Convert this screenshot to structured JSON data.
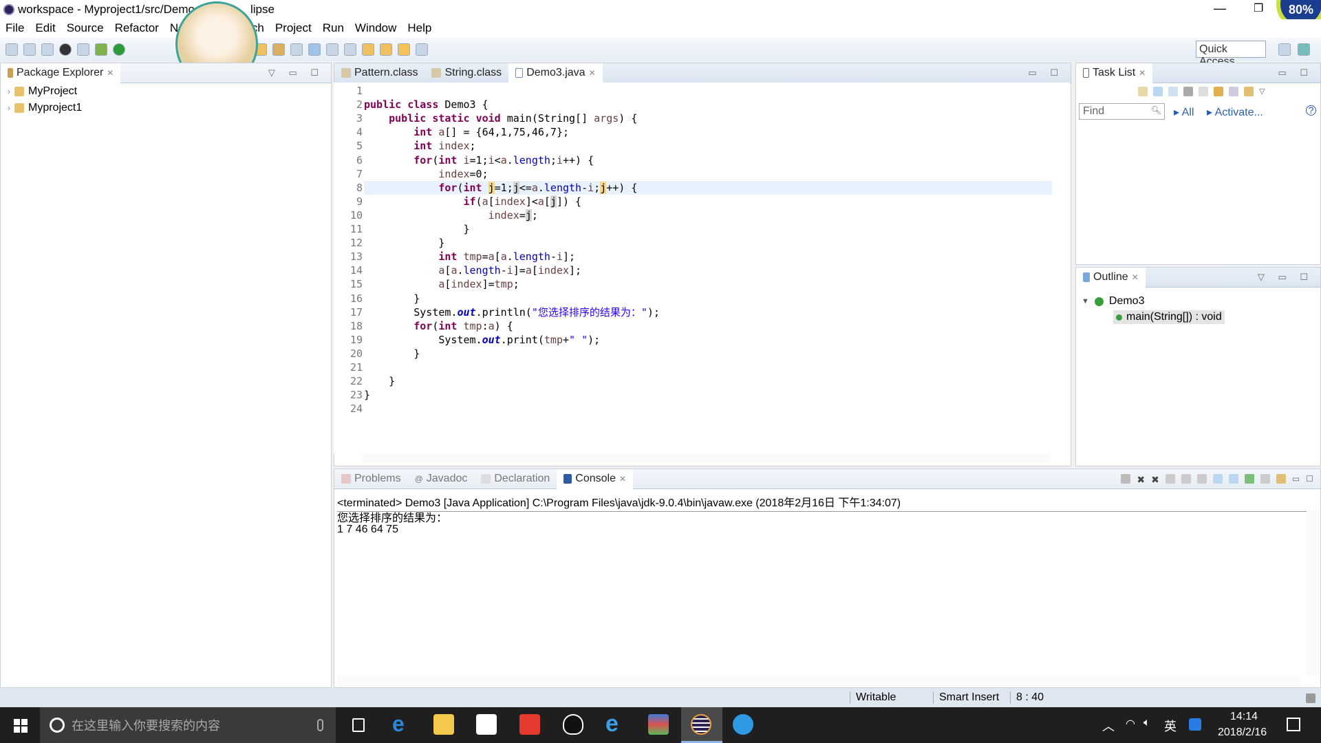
{
  "window": {
    "title": "workspace - Myproject1/src/Demo3.java - Eclipse",
    "title_visible": "workspace - Myproject1/src/Demo",
    "title_suffix": "lipse",
    "overlay_badge": "80%"
  },
  "menu": [
    "File",
    "Edit",
    "Source",
    "Refactor",
    "Navigate",
    "Search",
    "Project",
    "Run",
    "Window",
    "Help"
  ],
  "toolbar": {
    "quick_access": "Quick Access"
  },
  "package_explorer": {
    "title": "Package Explorer",
    "items": [
      "MyProject",
      "Myproject1"
    ]
  },
  "editor": {
    "tabs": [
      {
        "label": "Pattern.class",
        "active": false
      },
      {
        "label": "String.class",
        "active": false
      },
      {
        "label": "Demo3.java",
        "active": true
      }
    ],
    "current_line": 8,
    "lines": [
      [],
      [
        [
          "k",
          "public"
        ],
        [
          "t",
          " "
        ],
        [
          "k",
          "class"
        ],
        [
          "t",
          " Demo3 {"
        ]
      ],
      [
        [
          "t",
          "    "
        ],
        [
          "k",
          "public"
        ],
        [
          "t",
          " "
        ],
        [
          "k",
          "static"
        ],
        [
          "t",
          " "
        ],
        [
          "k",
          "void"
        ],
        [
          "t",
          " main(String[] "
        ],
        [
          "v",
          "args"
        ],
        [
          "t",
          ") {"
        ]
      ],
      [
        [
          "t",
          "        "
        ],
        [
          "k",
          "int"
        ],
        [
          "t",
          " "
        ],
        [
          "v",
          "a"
        ],
        [
          "t",
          "[] = {64,1,75,46,7};"
        ]
      ],
      [
        [
          "t",
          "        "
        ],
        [
          "k",
          "int"
        ],
        [
          "t",
          " "
        ],
        [
          "v",
          "index"
        ],
        [
          "t",
          ";"
        ]
      ],
      [
        [
          "t",
          "        "
        ],
        [
          "k",
          "for"
        ],
        [
          "t",
          "("
        ],
        [
          "k",
          "int"
        ],
        [
          "t",
          " "
        ],
        [
          "v",
          "i"
        ],
        [
          "t",
          "=1;"
        ],
        [
          "v",
          "i"
        ],
        [
          "t",
          "<"
        ],
        [
          "v",
          "a"
        ],
        [
          "t",
          "."
        ],
        [
          "f",
          "length"
        ],
        [
          "t",
          ";"
        ],
        [
          "v",
          "i"
        ],
        [
          "t",
          "++) {"
        ]
      ],
      [
        [
          "t",
          "            "
        ],
        [
          "v",
          "index"
        ],
        [
          "t",
          "=0;"
        ]
      ],
      [
        [
          "t",
          "            "
        ],
        [
          "k",
          "for"
        ],
        [
          "t",
          "("
        ],
        [
          "k",
          "int"
        ],
        [
          "t",
          " "
        ],
        [
          "occw",
          "j"
        ],
        [
          "t",
          "=1;"
        ],
        [
          "occ",
          "j"
        ],
        [
          "t",
          "<="
        ],
        [
          "v",
          "a"
        ],
        [
          "t",
          "."
        ],
        [
          "f",
          "length"
        ],
        [
          "t",
          "-"
        ],
        [
          "v",
          "i"
        ],
        [
          "t",
          ";"
        ],
        [
          "occw",
          "j"
        ],
        [
          "t",
          "++) {"
        ]
      ],
      [
        [
          "t",
          "                "
        ],
        [
          "k",
          "if"
        ],
        [
          "t",
          "("
        ],
        [
          "v",
          "a"
        ],
        [
          "t",
          "["
        ],
        [
          "v",
          "index"
        ],
        [
          "t",
          "]<"
        ],
        [
          "v",
          "a"
        ],
        [
          "t",
          "["
        ],
        [
          "occ",
          "j"
        ],
        [
          "t",
          "]) {"
        ]
      ],
      [
        [
          "t",
          "                    "
        ],
        [
          "v",
          "index"
        ],
        [
          "t",
          "="
        ],
        [
          "occ",
          "j"
        ],
        [
          "t",
          ";"
        ]
      ],
      [
        [
          "t",
          "                }"
        ]
      ],
      [
        [
          "t",
          "            }"
        ]
      ],
      [
        [
          "t",
          "            "
        ],
        [
          "k",
          "int"
        ],
        [
          "t",
          " "
        ],
        [
          "v",
          "tmp"
        ],
        [
          "t",
          "="
        ],
        [
          "v",
          "a"
        ],
        [
          "t",
          "["
        ],
        [
          "v",
          "a"
        ],
        [
          "t",
          "."
        ],
        [
          "f",
          "length"
        ],
        [
          "t",
          "-"
        ],
        [
          "v",
          "i"
        ],
        [
          "t",
          "];"
        ]
      ],
      [
        [
          "t",
          "            "
        ],
        [
          "v",
          "a"
        ],
        [
          "t",
          "["
        ],
        [
          "v",
          "a"
        ],
        [
          "t",
          "."
        ],
        [
          "f",
          "length"
        ],
        [
          "t",
          "-"
        ],
        [
          "v",
          "i"
        ],
        [
          "t",
          "]="
        ],
        [
          "v",
          "a"
        ],
        [
          "t",
          "["
        ],
        [
          "v",
          "index"
        ],
        [
          "t",
          "];"
        ]
      ],
      [
        [
          "t",
          "            "
        ],
        [
          "v",
          "a"
        ],
        [
          "t",
          "["
        ],
        [
          "v",
          "index"
        ],
        [
          "t",
          "]="
        ],
        [
          "v",
          "tmp"
        ],
        [
          "t",
          ";"
        ]
      ],
      [
        [
          "t",
          "        }"
        ]
      ],
      [
        [
          "t",
          "        System."
        ],
        [
          "o",
          "out"
        ],
        [
          "t",
          ".println("
        ],
        [
          "s",
          "\"您选择排序的结果为：\""
        ],
        [
          "t",
          ");"
        ]
      ],
      [
        [
          "t",
          "        "
        ],
        [
          "k",
          "for"
        ],
        [
          "t",
          "("
        ],
        [
          "k",
          "int"
        ],
        [
          "t",
          " "
        ],
        [
          "v",
          "tmp"
        ],
        [
          "t",
          ":"
        ],
        [
          "v",
          "a"
        ],
        [
          "t",
          ") {"
        ]
      ],
      [
        [
          "t",
          "            System."
        ],
        [
          "o",
          "out"
        ],
        [
          "t",
          ".print("
        ],
        [
          "v",
          "tmp"
        ],
        [
          "t",
          "+"
        ],
        [
          "s",
          "\" \""
        ],
        [
          "t",
          ");"
        ]
      ],
      [
        [
          "t",
          "        }"
        ]
      ],
      [],
      [
        [
          "t",
          "    }"
        ]
      ],
      [
        [
          "t",
          "}"
        ]
      ],
      []
    ]
  },
  "task_list": {
    "title": "Task List",
    "find_placeholder": "Find",
    "all": "All",
    "activate": "Activate..."
  },
  "outline": {
    "title": "Outline",
    "class": "Demo3",
    "method": "main(String[]) : void"
  },
  "bottom": {
    "tabs": [
      {
        "label": "Problems",
        "active": false
      },
      {
        "label": "Javadoc",
        "active": false
      },
      {
        "label": "Declaration",
        "active": false
      },
      {
        "label": "Console",
        "active": true
      }
    ],
    "console_header": "<terminated> Demo3 [Java Application] C:\\Program Files\\java\\jdk-9.0.4\\bin\\javaw.exe (2018年2月16日 下午1:34:07)",
    "output": [
      "您选择排序的结果为：",
      "1 7 46 64 75"
    ]
  },
  "status": {
    "writable": "Writable",
    "insert_mode": "Smart Insert",
    "position": "8 : 40"
  },
  "taskbar": {
    "search_placeholder": "在这里输入你要搜索的内容",
    "time": "14:14",
    "date": "2018/2/16",
    "ime": "英"
  }
}
